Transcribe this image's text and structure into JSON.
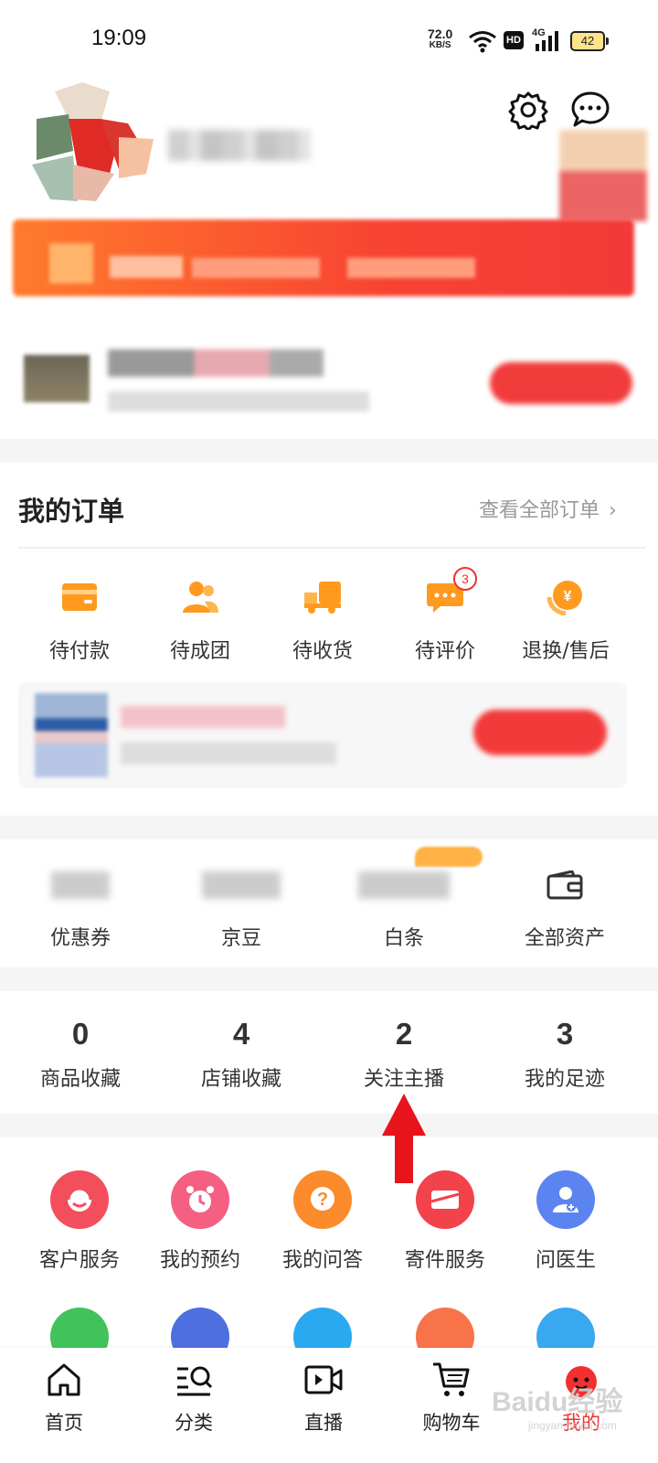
{
  "status_bar": {
    "time": "19:09",
    "net_speed": "72.0",
    "net_unit": "KB/S",
    "hd": "HD",
    "net_type": "4G",
    "battery": "42"
  },
  "orders": {
    "title": "我的订单",
    "view_all": "查看全部订单",
    "items": [
      {
        "label": "待付款",
        "icon": "wallet-card-icon"
      },
      {
        "label": "待成团",
        "icon": "group-icon"
      },
      {
        "label": "待收货",
        "icon": "delivery-truck-icon"
      },
      {
        "label": "待评价",
        "icon": "comment-icon",
        "badge": "3"
      },
      {
        "label": "退换/售后",
        "icon": "refund-icon"
      }
    ]
  },
  "assets": [
    {
      "label": "优惠券"
    },
    {
      "label": "京豆"
    },
    {
      "label": "白条"
    },
    {
      "label": "全部资产",
      "icon": "wallet-icon"
    }
  ],
  "counts": [
    {
      "value": "0",
      "label": "商品收藏"
    },
    {
      "value": "4",
      "label": "店铺收藏"
    },
    {
      "value": "2",
      "label": "关注主播"
    },
    {
      "value": "3",
      "label": "我的足迹"
    }
  ],
  "services": [
    {
      "label": "客户服务",
      "icon": "customer-service-icon",
      "color": "#f34e5c"
    },
    {
      "label": "我的预约",
      "icon": "alarm-clock-icon",
      "color": "#f45f82"
    },
    {
      "label": "我的问答",
      "icon": "question-icon",
      "color": "#fb8b2b"
    },
    {
      "label": "寄件服务",
      "icon": "envelope-icon",
      "color": "#f2424c"
    },
    {
      "label": "问医生",
      "icon": "doctor-icon",
      "color": "#5b84f1"
    }
  ],
  "services_row2_colors": [
    "#41c25a",
    "#4d6fe0",
    "#2aa8f0",
    "#f8734a",
    "#38a8f0"
  ],
  "nav": [
    {
      "label": "首页",
      "icon": "home-icon"
    },
    {
      "label": "分类",
      "icon": "category-search-icon"
    },
    {
      "label": "直播",
      "icon": "live-video-icon"
    },
    {
      "label": "购物车",
      "icon": "shopping-cart-icon"
    },
    {
      "label": "我的",
      "icon": "profile-mascot-icon",
      "active": true
    }
  ],
  "watermark": {
    "text": "Baidu经验",
    "sub": "jingyan.baidu.com"
  },
  "colors": {
    "accent": "#f23030",
    "icon_orange": "#ff9a1f"
  }
}
